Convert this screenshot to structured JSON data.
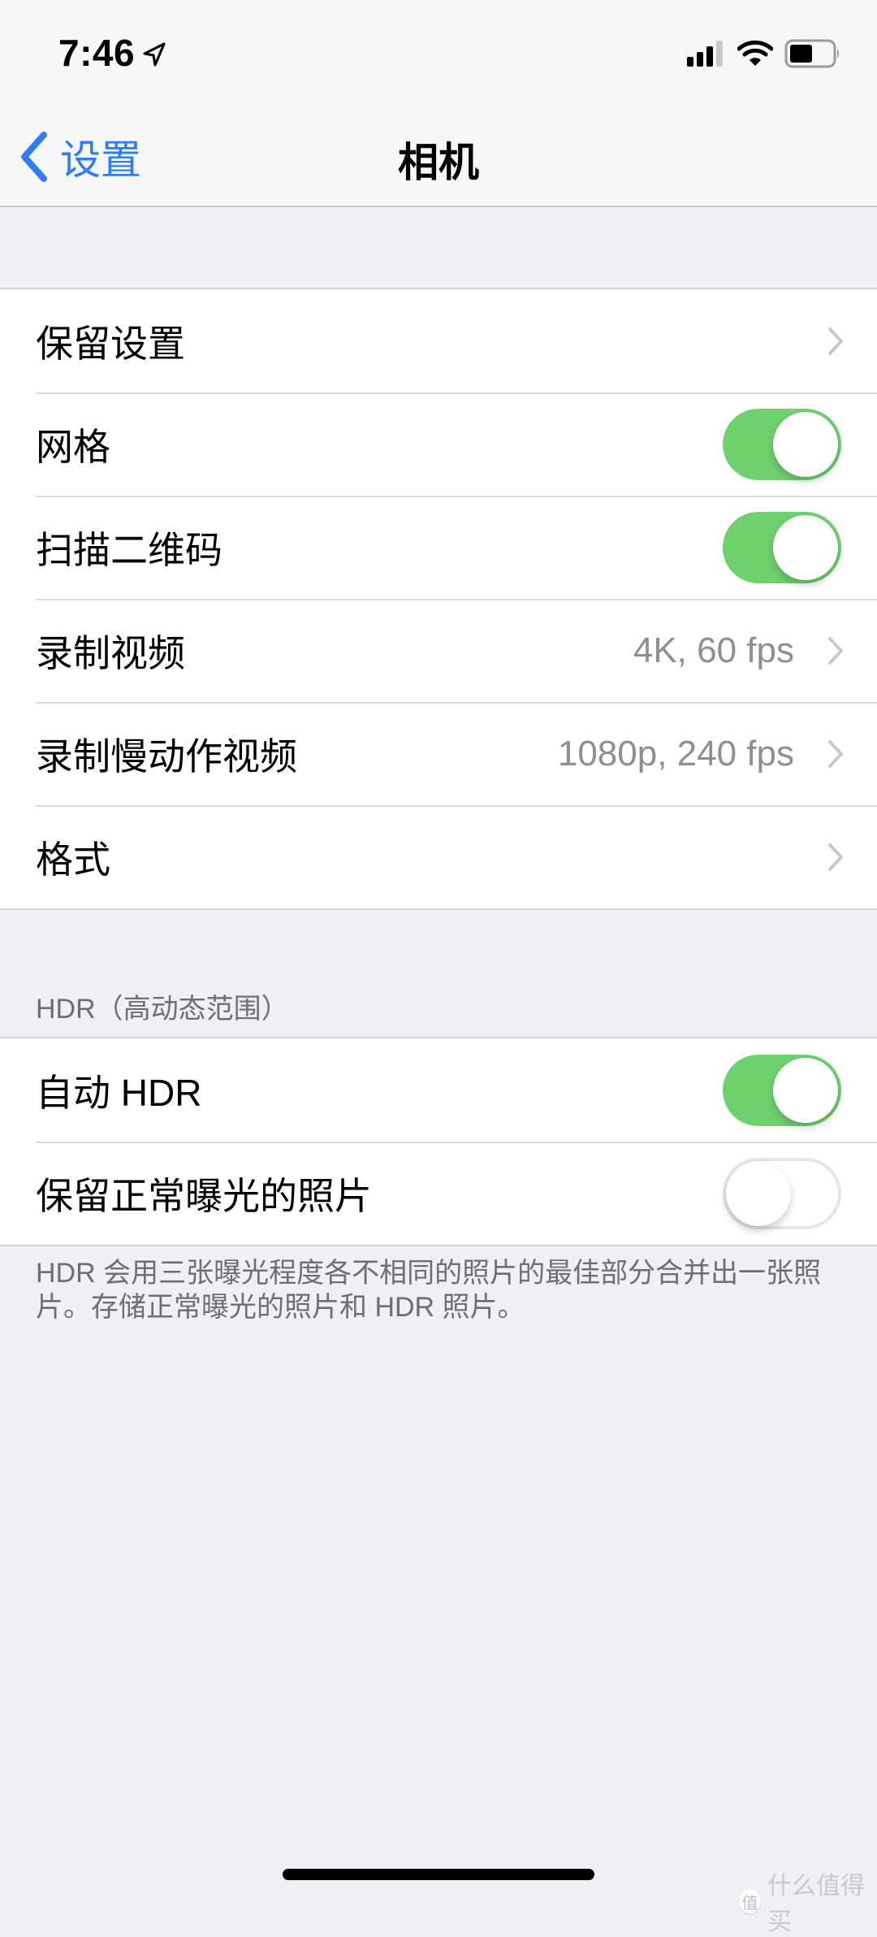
{
  "status_bar": {
    "time": "7:46",
    "icons": [
      "location-arrow-icon",
      "cellular-signal-icon",
      "wifi-icon",
      "battery-icon"
    ],
    "signal_bars": 3,
    "signal_bars_total": 4,
    "battery_level": 0.5
  },
  "nav": {
    "back_label": "设置",
    "title": "相机"
  },
  "colors": {
    "accent": "#2f7cf6",
    "toggle_on": "#6fd06e",
    "background": "#efeff4",
    "secondary_text": "#8e8e93"
  },
  "group1": {
    "rows": [
      {
        "label": "保留设置",
        "type": "disclosure",
        "value": ""
      },
      {
        "label": "网格",
        "type": "toggle",
        "on": true
      },
      {
        "label": "扫描二维码",
        "type": "toggle",
        "on": true
      },
      {
        "label": "录制视频",
        "type": "disclosure",
        "value": "4K, 60 fps"
      },
      {
        "label": "录制慢动作视频",
        "type": "disclosure",
        "value": "1080p, 240 fps"
      },
      {
        "label": "格式",
        "type": "disclosure",
        "value": ""
      }
    ]
  },
  "hdr_section": {
    "header": "HDR（高动态范围）",
    "rows": [
      {
        "label": "自动 HDR",
        "type": "toggle",
        "on": true
      },
      {
        "label": "保留正常曝光的照片",
        "type": "toggle",
        "on": false
      }
    ],
    "footer": "HDR 会用三张曝光程度各不相同的照片的最佳部分合并出一张照片。存储正常曝光的照片和 HDR 照片。"
  },
  "watermark": {
    "badge": "值",
    "text": "什么值得买"
  }
}
